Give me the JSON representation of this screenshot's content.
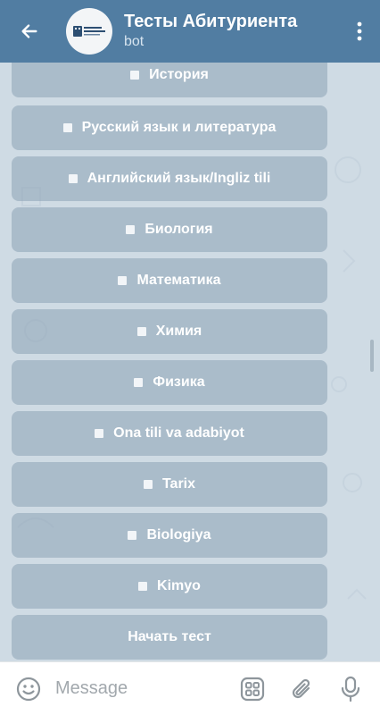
{
  "header": {
    "title": "Тесты Абитуриента",
    "subtitle": "bot",
    "back_icon": "arrow-left-icon",
    "more_icon": "more-vertical-icon",
    "avatar_icon": "bot-logo-icon",
    "color": "#517da2"
  },
  "keyboard": {
    "buttons": [
      {
        "label": "История",
        "bullet": true
      },
      {
        "label": "Русский язык и литература",
        "bullet": true
      },
      {
        "label": "Английский язык/Ingliz tili",
        "bullet": true
      },
      {
        "label": "Биология",
        "bullet": true
      },
      {
        "label": "Математика",
        "bullet": true
      },
      {
        "label": "Химия",
        "bullet": true
      },
      {
        "label": "Физика",
        "bullet": true
      },
      {
        "label": "Ona tili va adabiyot",
        "bullet": true
      },
      {
        "label": "Tarix",
        "bullet": true
      },
      {
        "label": "Biologiya",
        "bullet": true
      },
      {
        "label": "Kimyo",
        "bullet": true
      },
      {
        "label": "Начать тест",
        "bullet": false
      }
    ]
  },
  "input": {
    "placeholder": "Message",
    "emoji_icon": "emoji-icon",
    "keyboard_icon": "bot-keyboard-icon",
    "attach_icon": "paperclip-icon",
    "mic_icon": "microphone-icon"
  }
}
